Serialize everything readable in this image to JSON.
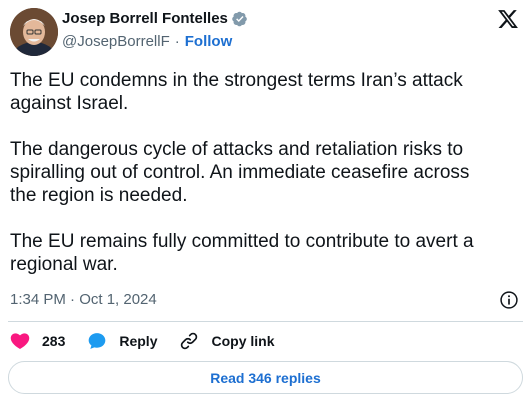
{
  "author": {
    "display_name": "Josep Borrell Fontelles",
    "handle": "@JosepBorrellF",
    "separator": "·",
    "follow_label": "Follow",
    "verified_icon": "verified-badge-icon",
    "avatar": "profile-photo"
  },
  "platform_icon": "x-logo-icon",
  "tweet": {
    "paragraphs": [
      [
        "The EU condemns in the strongest terms Iran’s attack",
        "against Israel."
      ],
      [
        "The dangerous cycle of attacks and retaliation risks to",
        "spiralling out of control. An immediate ceasefire across",
        "the region is needed."
      ],
      [
        "The EU remains fully committed to contribute to avert a",
        "regional war."
      ]
    ],
    "timestamp": "1:34 PM · Oct 1, 2024",
    "info_icon": "info-icon"
  },
  "actions": {
    "like_count": "283",
    "reply_label": "Reply",
    "copy_link_label": "Copy link"
  },
  "read_replies_label": "Read 346 replies",
  "colors": {
    "text": "#0f1419",
    "secondary": "#536471",
    "link": "#1d6fd1",
    "like": "#f91880",
    "reply": "#1d9bf0",
    "border": "#cfd9de"
  }
}
